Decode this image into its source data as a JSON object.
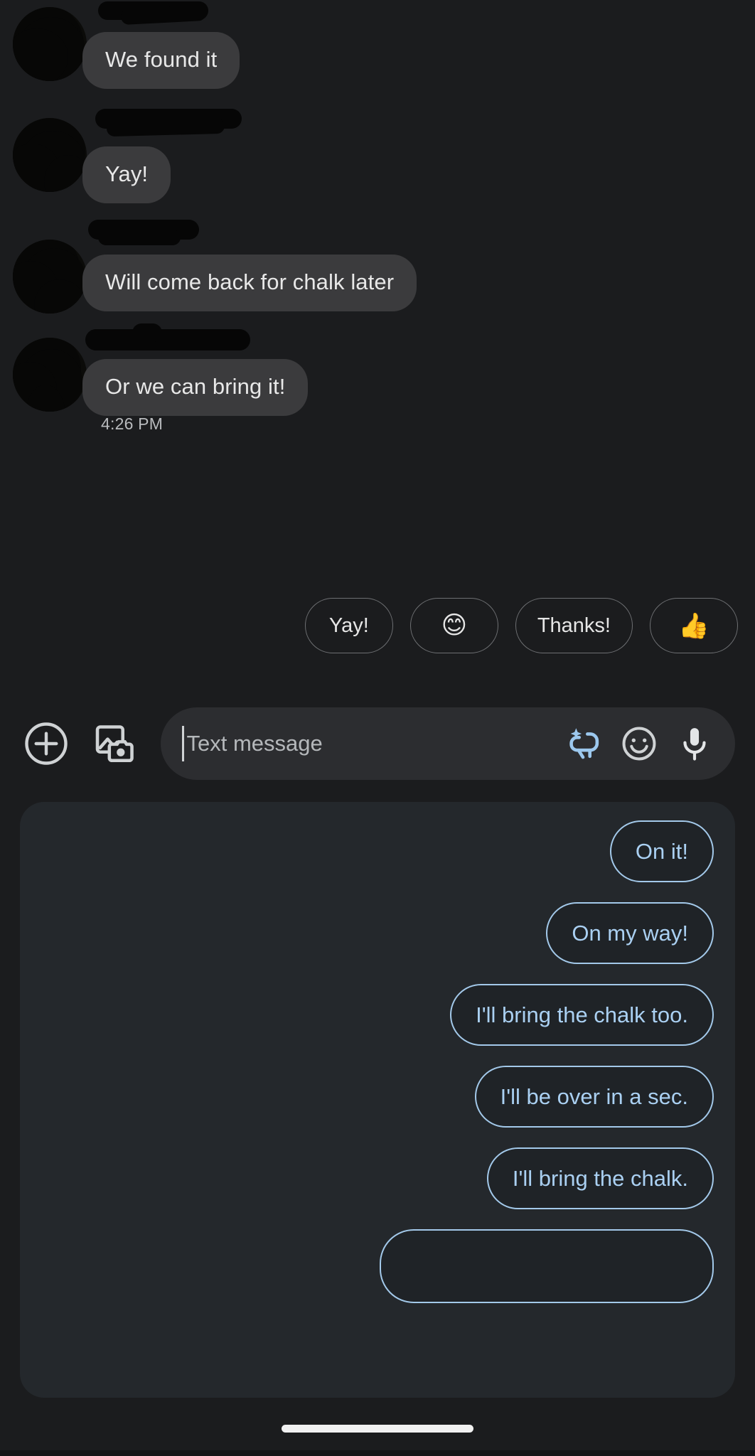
{
  "app": {
    "name": "Messages",
    "theme": "dark",
    "colors": {
      "background": "#1b1c1e",
      "incoming_bubble": "#3b3b3d",
      "incoming_text": "#e8e8e8",
      "suggestion_panel": "#24282c",
      "suggestion_border": "#a3c9ea",
      "suggestion_text": "#aad0f2",
      "quick_reply_border": "#6e7073",
      "accent_blue": "#9cc8ee"
    }
  },
  "thread": {
    "messages": [
      {
        "id": "msg-1",
        "text": "We found it",
        "sender": "incoming",
        "sender_name_redacted": true,
        "avatar_redacted": true
      },
      {
        "id": "msg-2",
        "text": "Yay!",
        "sender": "incoming",
        "sender_name_redacted": true,
        "avatar_redacted": true
      },
      {
        "id": "msg-3",
        "text": "Will come back for chalk later",
        "sender": "incoming",
        "sender_name_redacted": true,
        "avatar_redacted": true
      },
      {
        "id": "msg-4",
        "text": "Or we can bring it!",
        "sender": "incoming",
        "sender_name_redacted": true,
        "avatar_redacted": true
      }
    ],
    "timestamp": "4:26 PM"
  },
  "quick_replies": [
    {
      "id": "qr-yay",
      "label": "Yay!",
      "type": "text"
    },
    {
      "id": "qr-smile",
      "label": "😊",
      "type": "emoji",
      "icon_name": "smiling-face-with-smiling-eyes-emoji"
    },
    {
      "id": "qr-thanks",
      "label": "Thanks!",
      "type": "text"
    },
    {
      "id": "qr-thumbsup",
      "label": "👍",
      "type": "emoji",
      "icon_name": "thumbs-up-emoji"
    }
  ],
  "compose": {
    "placeholder": "Text message",
    "value": "",
    "left_icons": [
      {
        "id": "plus",
        "icon_name": "plus-circle-icon"
      },
      {
        "id": "gallery",
        "icon_name": "gallery-camera-icon"
      }
    ],
    "field_icons": [
      {
        "id": "magic-reply",
        "icon_name": "magic-smart-reply-icon",
        "color": "#9cc8ee"
      },
      {
        "id": "emoji",
        "icon_name": "emoji-face-icon",
        "color": "#cfd2d4"
      },
      {
        "id": "mic",
        "icon_name": "microphone-icon",
        "color": "#e3e5e7"
      }
    ]
  },
  "suggestion_panel": {
    "visible": true,
    "suggestions": [
      {
        "id": "s1",
        "text": "On it!"
      },
      {
        "id": "s2",
        "text": "On my way!"
      },
      {
        "id": "s3",
        "text": "I'll bring the chalk too."
      },
      {
        "id": "s4",
        "text": "I'll be over in a sec."
      },
      {
        "id": "s5",
        "text": "I'll bring the chalk."
      },
      {
        "id": "s6",
        "text": "",
        "partially_visible": true
      }
    ]
  },
  "system": {
    "home_indicator": true
  }
}
